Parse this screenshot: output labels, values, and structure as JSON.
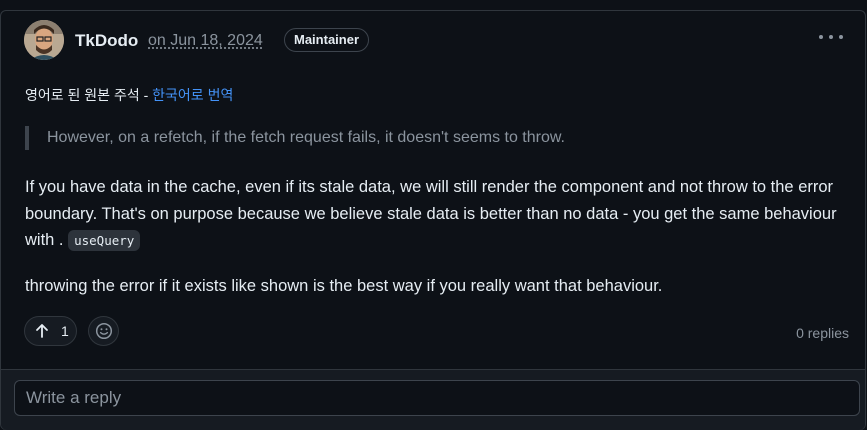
{
  "comment": {
    "author": "TkDodo",
    "date": "on Jun 18, 2024",
    "badge": "Maintainer",
    "translation_note": "영어로 된 원본 주석 - ",
    "translation_link": "한국어로 번역",
    "quote": "However, on a refetch, if the fetch request fails, it doesn't seems to throw.",
    "paragraph1_text": "If you have data in the cache, even if its stale data, we will still render the component and not throw to the error boundary. That's on purpose because we believe stale data is better than no data - you get the same behaviour with .",
    "paragraph1_code": "useQuery",
    "paragraph2": "throwing the error if it exists like shown is the best way if you really want that behaviour.",
    "upvote_count": "1",
    "replies": "0 replies"
  },
  "reply": {
    "placeholder": "Write a reply"
  },
  "icons": {
    "avatar": "avatar",
    "more": "kebab-horizontal-icon",
    "upvote": "arrow-up-icon",
    "emoji": "smiley-icon"
  }
}
